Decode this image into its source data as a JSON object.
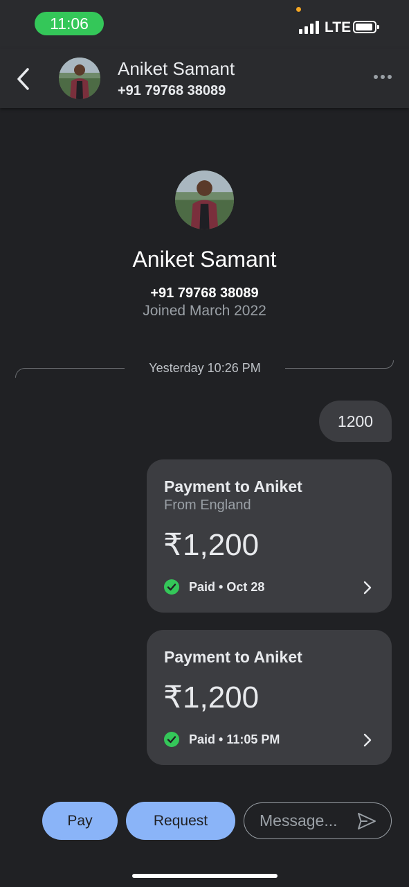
{
  "status_bar": {
    "time": "11:06",
    "network": "LTE"
  },
  "header": {
    "name": "Aniket Samant",
    "phone": "+91 79768 38089"
  },
  "profile": {
    "name": "Aniket Samant",
    "phone": "+91 79768 38089",
    "joined": "Joined March 2022"
  },
  "divider": {
    "timestamp": "Yesterday 10:26 PM"
  },
  "messages": [
    {
      "text": "1200"
    }
  ],
  "payments": [
    {
      "title": "Payment to Aniket",
      "subtitle": "From England",
      "amount": "₹1,200",
      "status": "Paid • Oct 28"
    },
    {
      "title": "Payment to Aniket",
      "amount": "₹1,200",
      "status": "Paid • 11:05 PM"
    }
  ],
  "actions": {
    "pay_label": "Pay",
    "request_label": "Request",
    "message_placeholder": "Message..."
  },
  "colors": {
    "accent": "#8ab4f8",
    "background": "#202124",
    "card": "#3c3d41",
    "paid_green": "#34c759"
  },
  "icons": [
    "back-arrow-icon",
    "more-options-icon",
    "check-circle-icon",
    "chevron-right-icon",
    "send-icon"
  ]
}
